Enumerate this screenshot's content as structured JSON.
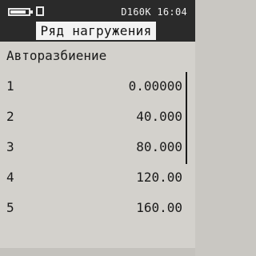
{
  "statusbar": {
    "battery_icon": "battery-icon",
    "battery_level": 0.85,
    "card_icon": "sd-card-icon",
    "device": "D160K",
    "time": "16:04"
  },
  "title": "Ряд нагружения",
  "section": {
    "label": "Авторазбиение"
  },
  "rows": [
    {
      "index": "1",
      "value": "0.00000"
    },
    {
      "index": "2",
      "value": "40.000"
    },
    {
      "index": "3",
      "value": "80.000"
    },
    {
      "index": "4",
      "value": "120.00"
    },
    {
      "index": "5",
      "value": "160.00"
    }
  ]
}
